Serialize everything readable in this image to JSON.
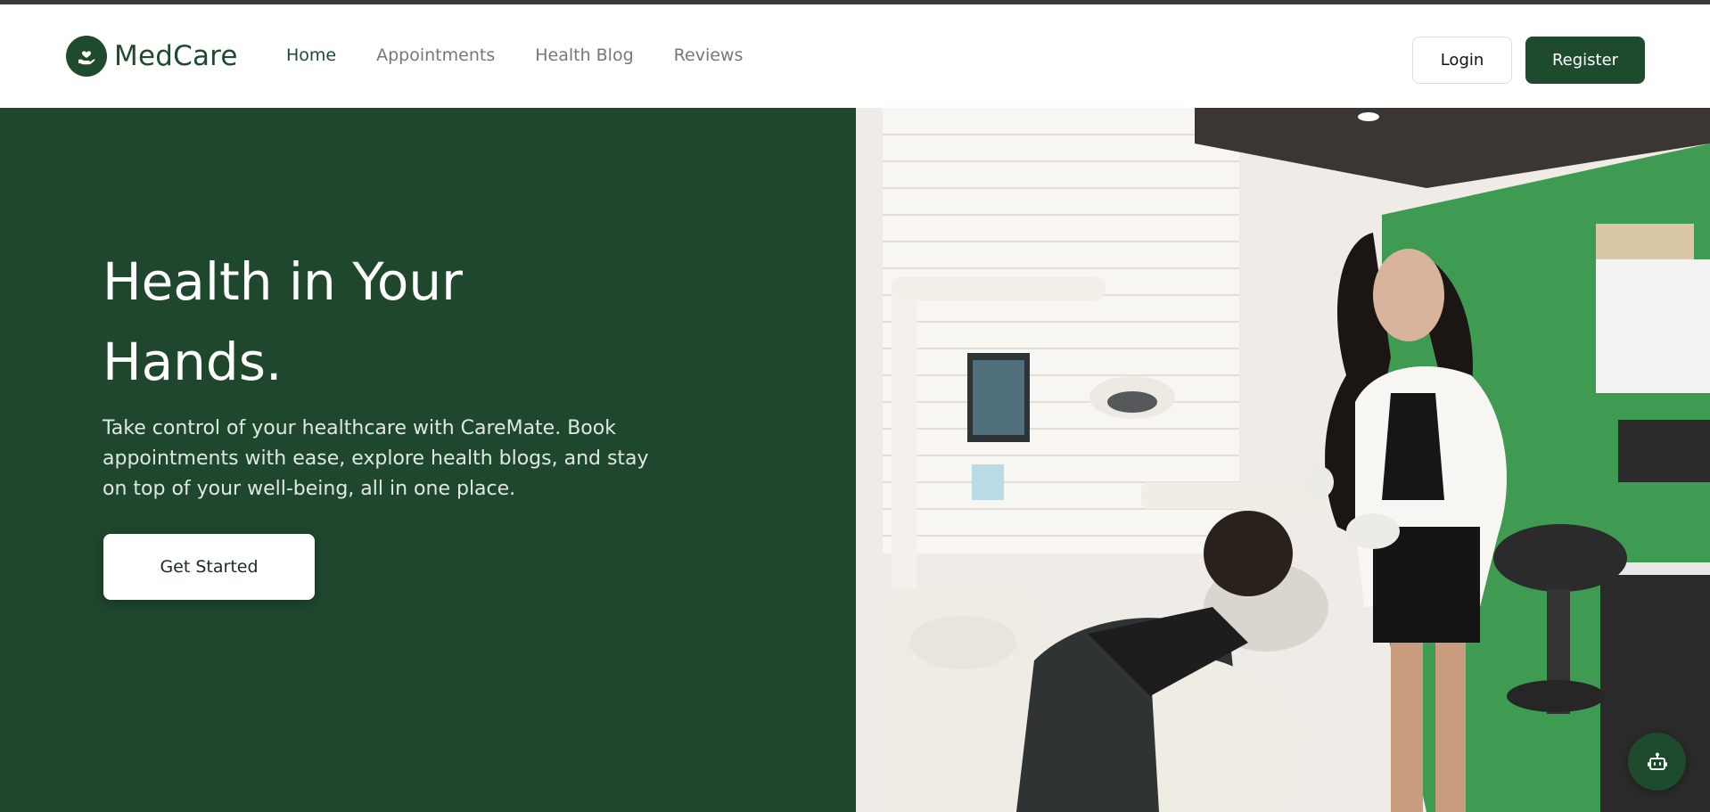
{
  "brand": {
    "name": "MedCare",
    "icon": "heart-in-hand-icon"
  },
  "nav": {
    "items": [
      {
        "label": "Home",
        "active": true
      },
      {
        "label": "Appointments",
        "active": false
      },
      {
        "label": "Health Blog",
        "active": false
      },
      {
        "label": "Reviews",
        "active": false
      }
    ]
  },
  "auth": {
    "login_label": "Login",
    "register_label": "Register"
  },
  "hero": {
    "title_line1": "Health in Your",
    "title_line2": "Hands.",
    "subtitle": "Take control of your healthcare with CareMate. Book appointments with ease, explore health blogs, and stay on top of your well-being, all in one place.",
    "cta_label": "Get Started",
    "image_alt": "Smiling dentist in a white coat beside a patient in a dental chair"
  },
  "chat": {
    "icon": "robot-icon"
  },
  "colors": {
    "primary": "#1e4a2e",
    "hero_bg": "#1e472d",
    "nav_inactive": "#777777",
    "accent_wall": "#3f9b52"
  }
}
